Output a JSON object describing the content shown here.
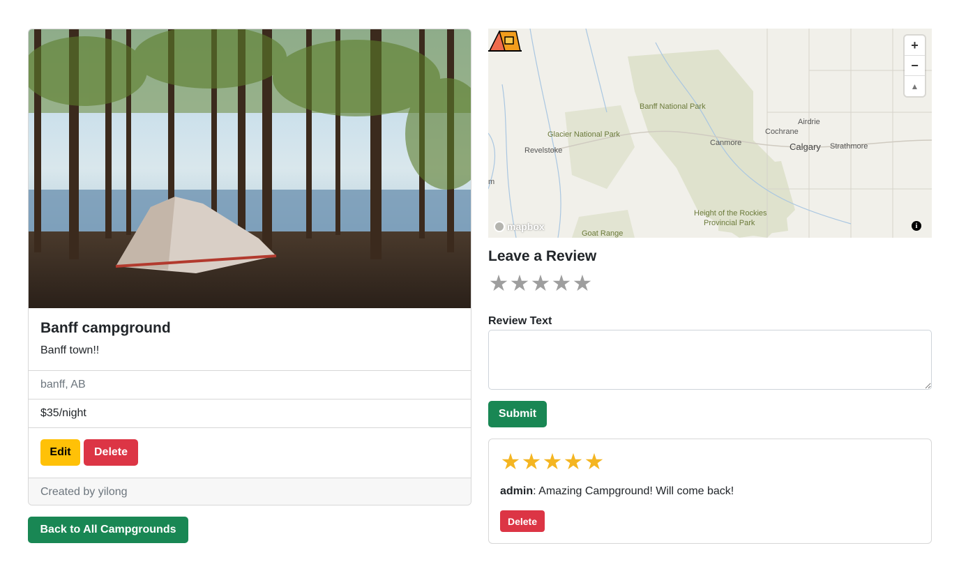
{
  "campground": {
    "title": "Banff campground",
    "description": "Banff town!!",
    "location": "banff, AB",
    "price": "$35/night",
    "edit_label": "Edit",
    "delete_label": "Delete",
    "footer": "Created by yilong"
  },
  "back_label": "Back to All Campgrounds",
  "map": {
    "labels": {
      "banff_np": "Banff National Park",
      "glacier_np": "Glacier National Park",
      "revelstoke": "Revelstoke",
      "airdrie": "Airdrie",
      "cochrane": "Cochrane",
      "calgary": "Calgary",
      "strathmore": "Strathmore",
      "canmore": "Canmore",
      "height_rockies": "Height of the Rockies",
      "provincial_park": "Provincial Park",
      "goat_range": "Goat Range",
      "edge_m": "m"
    },
    "zoom_in": "+",
    "zoom_out": "−",
    "compass": "▲",
    "logo": "mapbox",
    "info": "i"
  },
  "review_form": {
    "heading": "Leave a Review",
    "rating": 0,
    "text_label": "Review Text",
    "text_value": "",
    "submit_label": "Submit"
  },
  "reviews": [
    {
      "rating": 5,
      "author": "admin",
      "separator": ":",
      "body": " Amazing Campground! Will come back!",
      "delete_label": "Delete"
    }
  ],
  "colors": {
    "success": "#198754",
    "warning": "#ffc107",
    "danger": "#dc3545",
    "star_gold": "#f4b521",
    "star_grey": "#9e9e9e"
  }
}
